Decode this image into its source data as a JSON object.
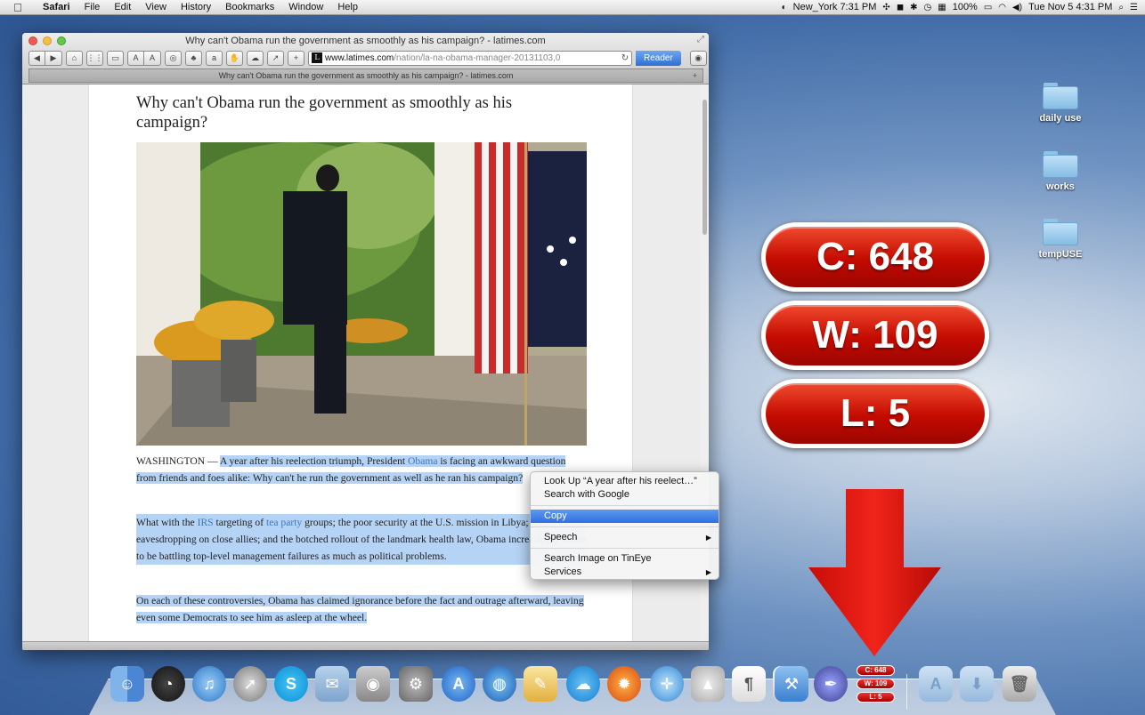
{
  "menubar": {
    "apple": "",
    "items": [
      "Safari",
      "File",
      "Edit",
      "View",
      "History",
      "Bookmarks",
      "Window",
      "Help"
    ],
    "clock_city": "New_York 7:31 PM",
    "battery": "100%",
    "datetime": "Tue Nov 5  4:31 PM"
  },
  "desktop": {
    "folders": [
      "daily use",
      "works",
      "tempUSE"
    ]
  },
  "counter": {
    "chars": "C: 648",
    "words": "W: 109",
    "lines": "L: 5"
  },
  "safari": {
    "title": "Why can't Obama run the government as smoothly as his campaign? - latimes.com",
    "url_host": "www.latimes.com",
    "url_path": "/nation/la-na-obama-manager-20131103,0",
    "reader_label": "Reader",
    "tab_title": "Why can't Obama run the government as smoothly as his campaign? - latimes.com",
    "toolbar_buttons": [
      "◀",
      "▶",
      "⌂",
      "⋮⋮",
      "▭",
      "A",
      "A",
      "◎",
      "♣",
      "a",
      "✋",
      "☁",
      "↗",
      "+"
    ]
  },
  "article": {
    "headline": "Why can't Obama run the government as smoothly as his campaign?",
    "p1_dateline": "WASHINGTON — ",
    "p1_a": "A year after his reelection triumph, President ",
    "p1_link": "Obama",
    "p1_b": " is facing an awkward question from friends and foes alike: Why can't he run the government as well as he ran his campaign?",
    "p2_a": "What with the ",
    "p2_link1": "IRS",
    "p2_b": " targeting of ",
    "p2_link2": "tea party",
    "p2_c": " groups; the poor security at the U.S. mission in Libya; the eavesdropping on close allies; and the botched rollout of the landmark health law, Obama increasingly seems to be battling top-level management failures as much as political problems.",
    "p3": "On each of these controversies, Obama has claimed ignorance before the fact and outrage afterward, leaving even some Democrats to see him as asleep at the wheel."
  },
  "context_menu": {
    "items": [
      {
        "label": "Look Up “A year after his reelect…”",
        "submenu": false
      },
      {
        "label": "Search with Google",
        "submenu": false
      },
      {
        "sep": true
      },
      {
        "label": "Copy",
        "submenu": false,
        "active": true
      },
      {
        "sep": true
      },
      {
        "label": "Speech",
        "submenu": true
      },
      {
        "sep": true
      },
      {
        "label": "Search Image on TinEye",
        "submenu": false
      },
      {
        "label": "Services",
        "submenu": true
      }
    ]
  },
  "dock": {
    "badges": [
      "C: 648",
      "W: 109",
      "L: 5"
    ],
    "apps": [
      "Finder",
      "Dashboard",
      "iTunes",
      "Launchpad",
      "Skype",
      "Preview",
      "FaceTime",
      "System Preferences",
      "App Store",
      "Google Earth",
      "Paintbrush",
      "OpenOffice",
      "Firefox",
      "Safari",
      "Grapher",
      "TextEdit",
      "Rocket",
      "Xcode",
      "Script Editor"
    ]
  }
}
